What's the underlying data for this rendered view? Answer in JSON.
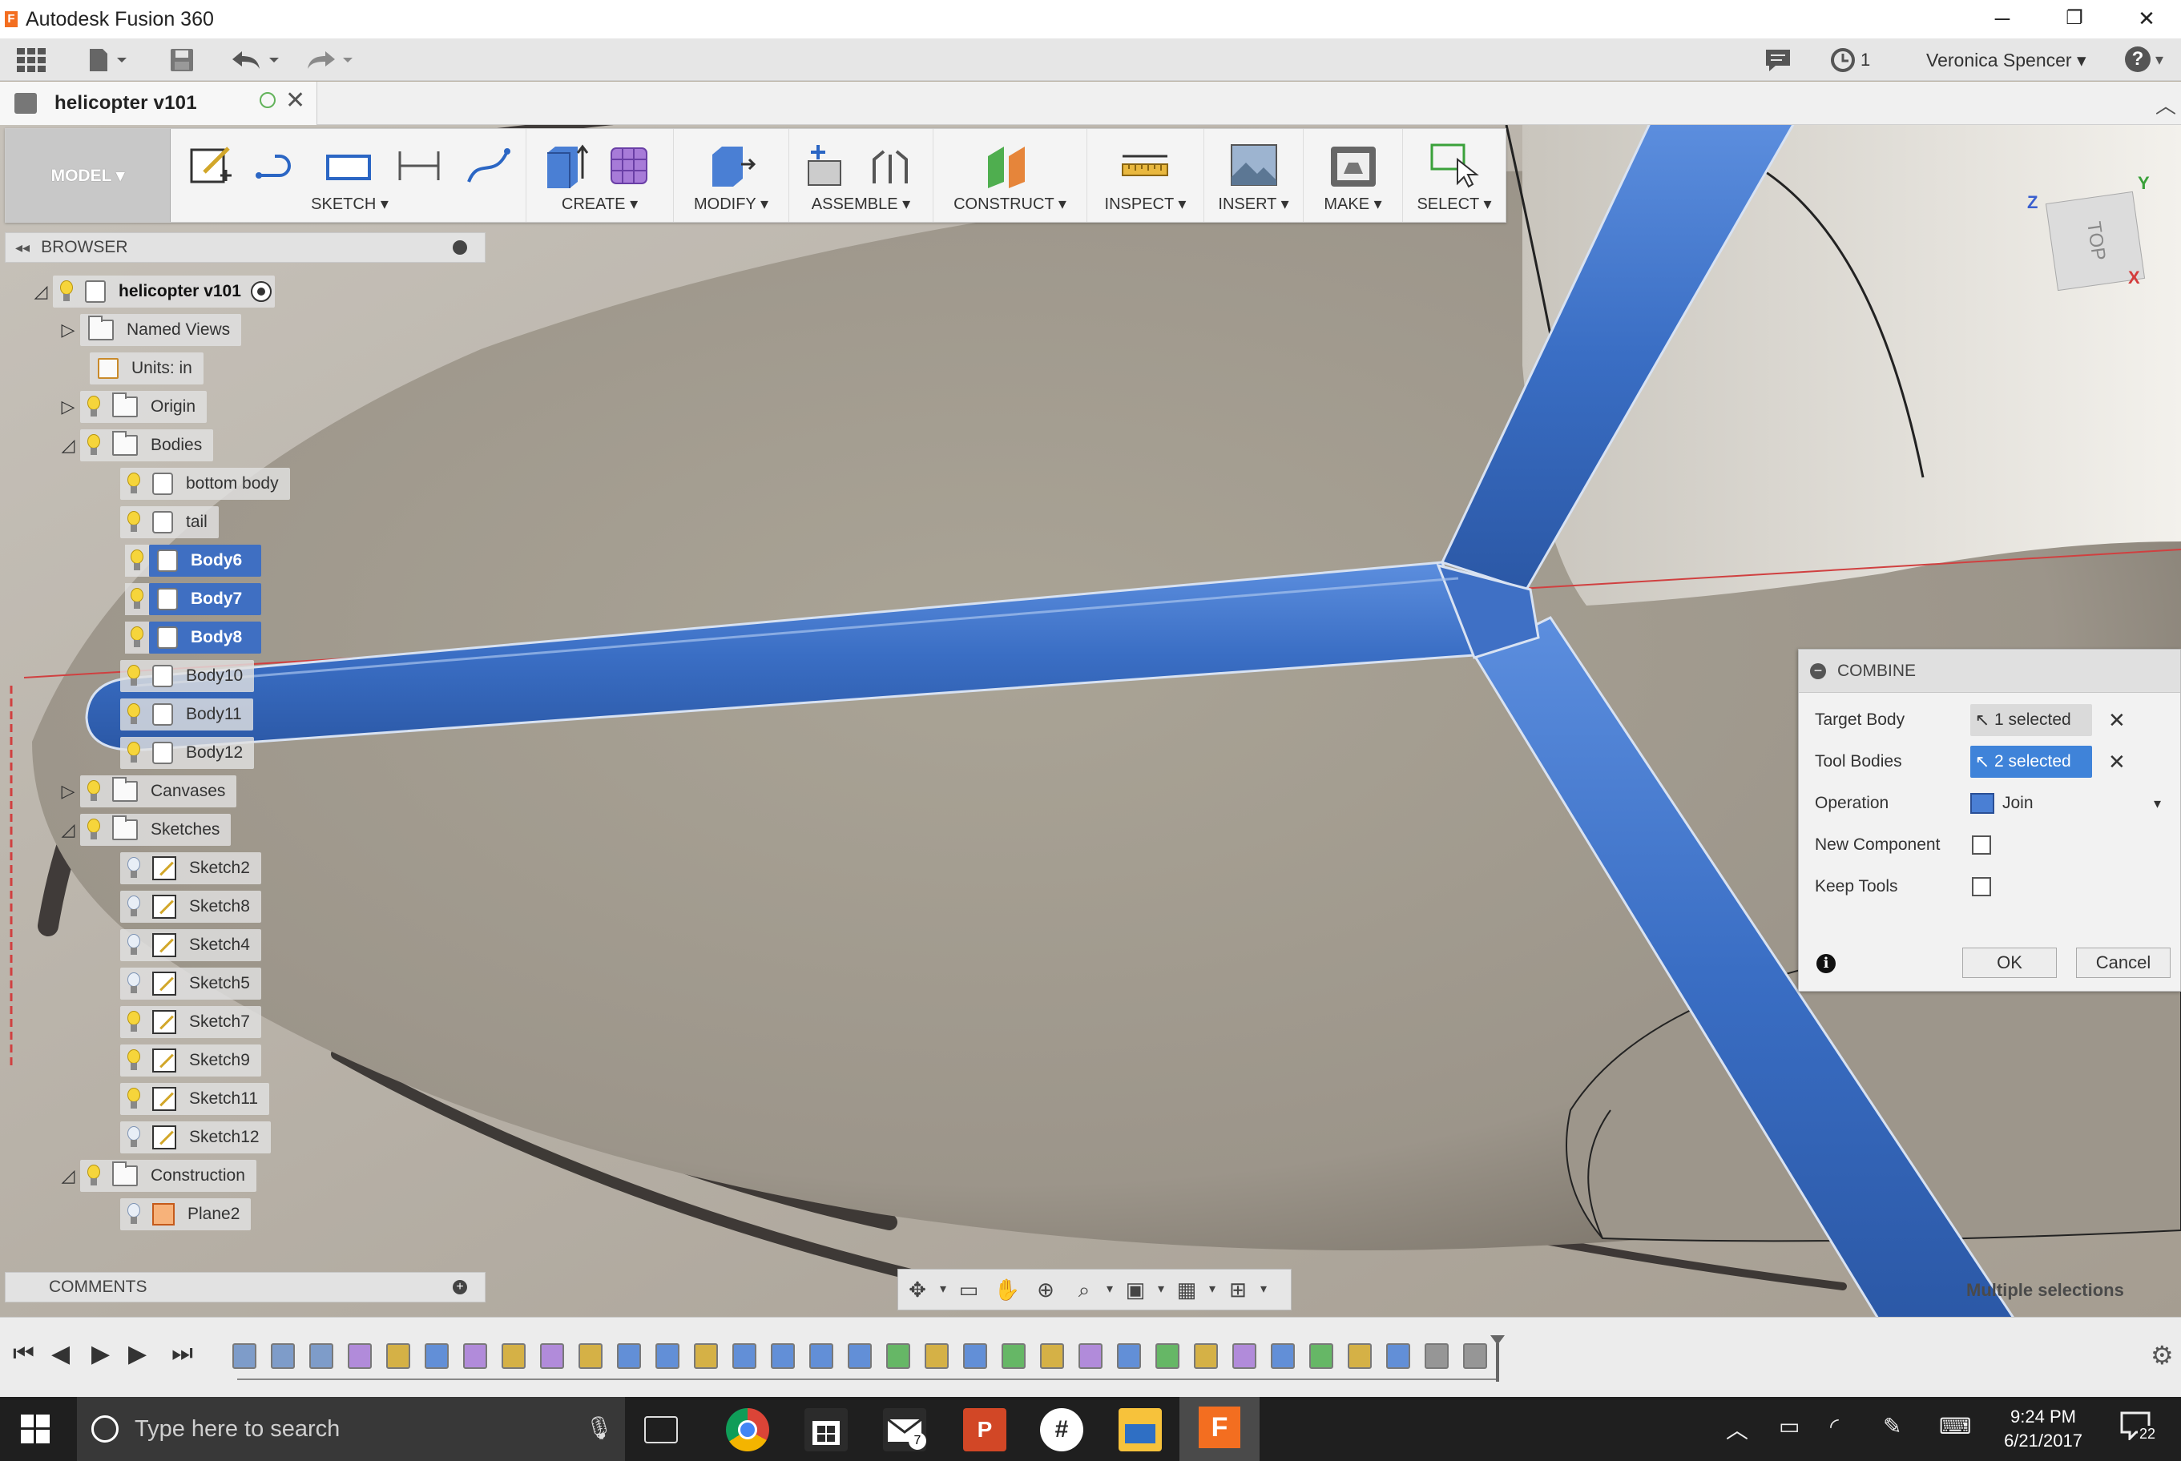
{
  "window": {
    "title": "Autodesk Fusion 360",
    "minimize_glyph": "─",
    "restore_glyph": "❐",
    "close_glyph": "✕"
  },
  "appbar": {
    "user": "Veronica Spencer ▾",
    "job_count": "1",
    "help": "?"
  },
  "tab": {
    "name": "helicopter v101"
  },
  "toolbar": {
    "workspace": "MODEL ▾",
    "groups": [
      "SKETCH ▾",
      "CREATE ▾",
      "MODIFY ▾",
      "ASSEMBLE ▾",
      "CONSTRUCT ▾",
      "INSPECT ▾",
      "INSERT ▾",
      "MAKE ▾",
      "SELECT ▾"
    ]
  },
  "browser": {
    "title": "BROWSER",
    "root": "helicopter v101",
    "named_views": "Named Views",
    "units": "Units: in",
    "origin": "Origin",
    "bodies": "Bodies",
    "body_items": [
      "bottom body",
      "tail",
      "Body6",
      "Body7",
      "Body8",
      "Body10",
      "Body11",
      "Body12"
    ],
    "canvases": "Canvases",
    "sketches": "Sketches",
    "sketch_items": [
      "Sketch2",
      "Sketch8",
      "Sketch4",
      "Sketch5",
      "Sketch7",
      "Sketch9",
      "Sketch11",
      "Sketch12"
    ],
    "construction": "Construction",
    "construction_items": [
      "Plane2"
    ]
  },
  "comments": {
    "title": "COMMENTS"
  },
  "viewcube": {
    "face": "TOP",
    "axis_z": "Z",
    "axis_y": "Y",
    "axis_x": "X"
  },
  "combine": {
    "title": "COMBINE",
    "target_label": "Target Body",
    "target_value": "1 selected",
    "tool_label": "Tool Bodies",
    "tool_value": "2 selected",
    "operation_label": "Operation",
    "operation_value": "Join",
    "new_component_label": "New Component",
    "keep_tools_label": "Keep Tools",
    "ok": "OK",
    "cancel": "Cancel"
  },
  "status": {
    "multiple": "Multiple selections"
  },
  "taskbar": {
    "search_placeholder": "Type here to search",
    "time": "9:24 PM",
    "date": "6/21/2017",
    "notifications": "22",
    "mail_count": "7"
  },
  "colors": {
    "selection_blue": "#3f6fc2",
    "fusion_orange": "#f36e20"
  }
}
